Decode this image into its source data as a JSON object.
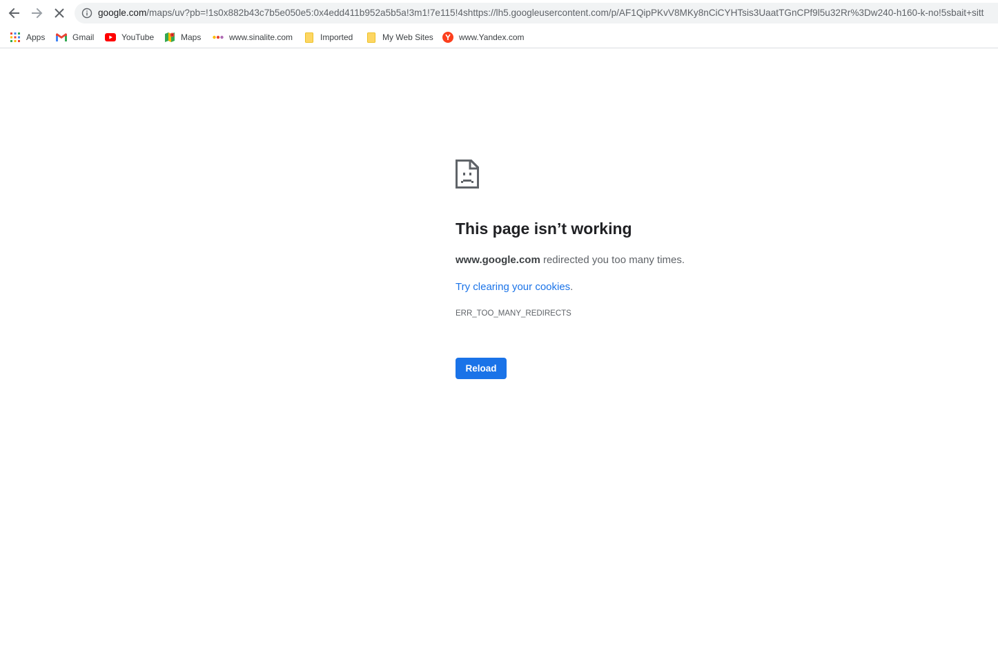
{
  "toolbar": {
    "back_icon": "arrow-left-icon",
    "forward_icon": "arrow-right-icon",
    "stop_icon": "close-icon",
    "info_icon": "info-icon",
    "url_host": "google.com",
    "url_rest": "/maps/uv?pb=!1s0x882b43c7b5e050e5:0x4edd411b952a5b5a!3m1!7e115!4shttps://lh5.googleusercontent.com/p/AF1QipPKvV8MKy8nCiCYHTsis3UaatTGnCPf9l5u32Rr%3Dw240-h160-k-no!5sbait+sitt"
  },
  "bookmarks": {
    "items": [
      {
        "label": "Apps",
        "icon": "apps-grid-icon"
      },
      {
        "label": "Gmail",
        "icon": "gmail-icon"
      },
      {
        "label": "YouTube",
        "icon": "youtube-icon"
      },
      {
        "label": "Maps",
        "icon": "maps-icon"
      },
      {
        "label": "www.sinalite.com",
        "icon": "dots-icon"
      },
      {
        "label": "Imported",
        "icon": "folder-icon"
      },
      {
        "label": "My Web Sites",
        "icon": "folder-icon"
      },
      {
        "label": "www.Yandex.com",
        "icon": "yandex-icon"
      }
    ]
  },
  "error": {
    "icon": "sad-page-icon",
    "title": "This page isn’t working",
    "host": "www.google.com",
    "description": " redirected you too many times.",
    "suggestion_link": "Try clearing your cookies",
    "suggestion_end": ".",
    "code": "ERR_TOO_MANY_REDIRECTS",
    "reload_label": "Reload"
  },
  "colors": {
    "accent": "#1a73e8",
    "text": "#202124",
    "secondary_text": "#5f6368",
    "omnibox_bg": "#f1f3f4"
  }
}
